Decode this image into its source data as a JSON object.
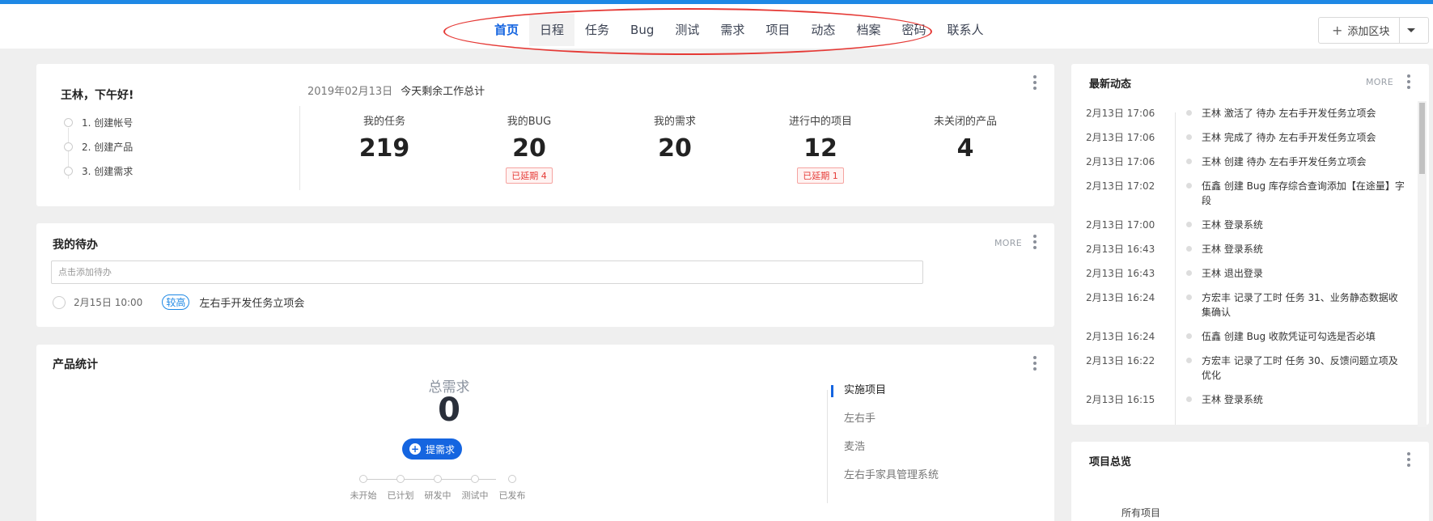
{
  "nav": {
    "items": [
      "首页",
      "日程",
      "任务",
      "Bug",
      "测试",
      "需求",
      "项目",
      "动态",
      "档案",
      "密码",
      "联系人"
    ],
    "active": "首页",
    "hover": "日程"
  },
  "toolbar": {
    "add_block_label": "添加区块"
  },
  "welcome": {
    "greeting": "王林，下午好!",
    "steps": [
      "1. 创建帐号",
      "2. 创建产品",
      "3. 创建需求"
    ],
    "date": "2019年02月13日",
    "summary_title": "今天剩余工作总计",
    "stats": [
      {
        "label": "我的任务",
        "value": "219",
        "badge": ""
      },
      {
        "label": "我的BUG",
        "value": "20",
        "badge": "已延期 4"
      },
      {
        "label": "我的需求",
        "value": "20",
        "badge": ""
      },
      {
        "label": "进行中的项目",
        "value": "12",
        "badge": "已延期 1"
      },
      {
        "label": "未关闭的产品",
        "value": "4",
        "badge": ""
      }
    ]
  },
  "todo": {
    "title": "我的待办",
    "more": "MORE",
    "placeholder": "点击添加待办",
    "items": [
      {
        "date": "2月15日 10:00",
        "priority": "较高",
        "text": "左右手开发任务立项会"
      }
    ]
  },
  "product": {
    "title": "产品统计",
    "total_label": "总需求",
    "total_value": "0",
    "new_req_label": "提需求",
    "flow": [
      "未开始",
      "已计划",
      "研发中",
      "测试中",
      "已发布"
    ],
    "products": [
      "实施项目",
      "左右手",
      "麦浩",
      "左右手家具管理系统"
    ],
    "active_product": "实施项目"
  },
  "activity": {
    "title": "最新动态",
    "more": "MORE",
    "items": [
      {
        "time": "2月13日 17:06",
        "text": "王林 激活了 待办 左右手开发任务立项会"
      },
      {
        "time": "2月13日 17:06",
        "text": "王林 完成了 待办 左右手开发任务立项会"
      },
      {
        "time": "2月13日 17:06",
        "text": "王林 创建 待办 左右手开发任务立项会"
      },
      {
        "time": "2月13日 17:02",
        "text": "伍鑫 创建 Bug 库存综合查询添加【在途量】字段"
      },
      {
        "time": "2月13日 17:00",
        "text": "王林 登录系统"
      },
      {
        "time": "2月13日 16:43",
        "text": "王林 登录系统"
      },
      {
        "time": "2月13日 16:43",
        "text": "王林 退出登录"
      },
      {
        "time": "2月13日 16:24",
        "text": "方宏丰 记录了工时 任务 31、业务静态数据收集确认"
      },
      {
        "time": "2月13日 16:24",
        "text": "伍鑫 创建 Bug 收款凭证可勾选是否必填"
      },
      {
        "time": "2月13日 16:22",
        "text": "方宏丰 记录了工时 任务 30、反馈问题立项及优化"
      },
      {
        "time": "2月13日 16:15",
        "text": "王林 登录系统"
      }
    ]
  },
  "projects": {
    "title": "项目总览",
    "all_label": "所有项目"
  },
  "colors": {
    "accent": "#1565e0",
    "top_stripe": "#1e88e5",
    "annotation": "#e53935"
  }
}
